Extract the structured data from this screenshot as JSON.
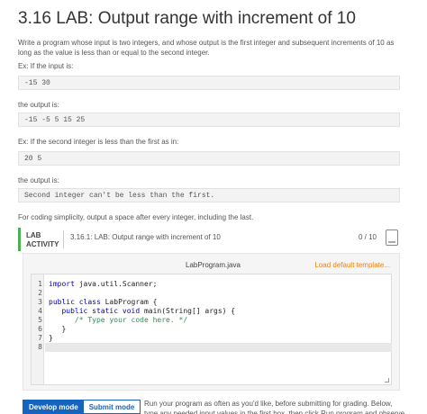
{
  "title": "3.16 LAB: Output range with increment of 10",
  "description": "Write a program whose input is two integers, and whose output is the first integer and subsequent increments of 10 as long as the value is less than or equal to the second integer.",
  "ex_input_label": "Ex: If the input is:",
  "ex_input": "-15 30",
  "output_label_1": "the output is:",
  "ex_output": "-15 -5 5 15 25",
  "ex2_label": "Ex: If the second integer is less than the first as in:",
  "ex2_input": "20 5",
  "output_label_2": "the output is:",
  "ex2_output": "Second integer can't be less than the first.",
  "simplicity_note": "For coding simplicity, output a space after every integer, including the last.",
  "lab": {
    "tag_line1": "LAB",
    "tag_line2": "ACTIVITY",
    "name": "3.16.1: LAB: Output range with increment of 10",
    "score": "0 / 10"
  },
  "editor": {
    "filename": "LabProgram.java",
    "load_template": "Load default template...",
    "line_numbers": [
      "1",
      "2",
      "3",
      "4",
      "5",
      "6",
      "7",
      "8"
    ],
    "lines": [
      {
        "kw": "import",
        "rest": " java.util.Scanner;"
      },
      {
        "kw": "",
        "rest": ""
      },
      {
        "kw": "public class",
        "rest": " LabProgram {"
      },
      {
        "kw": "   public static void",
        "rest": " main(String[] args) {"
      },
      {
        "kw": "",
        "rest": "      ",
        "comment": "/* Type your code here. */"
      },
      {
        "kw": "",
        "rest": "   }"
      },
      {
        "kw": "",
        "rest": "}"
      },
      {
        "kw": "",
        "rest": ""
      }
    ]
  },
  "modes": {
    "develop": "Develop mode",
    "submit": "Submit mode"
  },
  "footer_text": "Run your program as often as you'd like, before submitting for grading. Below, type any needed input values in the first box, then click Run program and observe"
}
